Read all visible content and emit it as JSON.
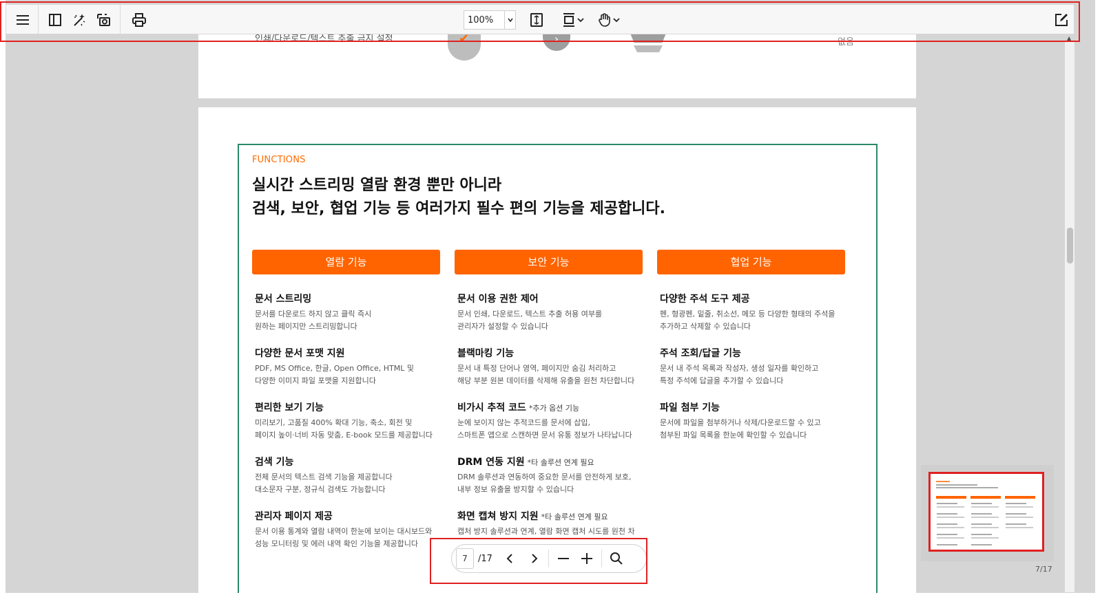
{
  "toolbar": {
    "menu_icon": "hamburger-menu-icon",
    "sidebar_icon": "sidebar-panel-icon",
    "tools": [
      "sidebar-panel-icon",
      "magic-wand-icon",
      "capture-icon",
      "print-icon"
    ],
    "zoom_value": "100%",
    "fit_page_icon": "fit-page-icon",
    "scroll_mode_icon": "vertical-scroll-icon",
    "hand_tool_icon": "hand-tool-icon",
    "edit_icon": "edit-icon"
  },
  "previous_page": {
    "text": "인쇄/다운로드/텍스트 추출 금지 설정",
    "right_text": "없음"
  },
  "page": {
    "label": "FUNCTIONS",
    "headline_line1": "실시간 스트리밍 열람 환경 뿐만 아니라",
    "headline_line2": "검색, 보안, 협업 기능 등 여러가지 필수 편의 기능을 제공합니다.",
    "columns": [
      {
        "header": "열람 기능",
        "items": [
          {
            "title": "문서 스트리밍",
            "note": "",
            "desc1": "문서를 다운로드 하지 않고 클릭 즉시",
            "desc2": "원하는 페이지만 스트리밍합니다"
          },
          {
            "title": "다양한 문서 포맷 지원",
            "note": "",
            "desc1": "PDF, MS Office, 한글, Open Office, HTML 및",
            "desc2": "다양한 이미지 파일 포맷을 지원합니다"
          },
          {
            "title": "편리한 보기 기능",
            "note": "",
            "desc1": "미리보기, 고품질 400% 확대 기능, 축소, 회전 및",
            "desc2": "페이지 높이·너비 자동 맞춤, E-book 모드를 제공합니다"
          },
          {
            "title": "검색 기능",
            "note": "",
            "desc1": "전체 문서의 텍스트 검색 기능을 제공합니다",
            "desc2": "대소문자 구분, 정규식 검색도 가능합니다"
          },
          {
            "title": "관리자 페이지 제공",
            "note": "",
            "desc1": "문서 이용 통계와 열람 내역이 한눈에 보이는 대시보드와",
            "desc2": "성능 모니터링 및 에러 내역 확인 기능을 제공합니다"
          }
        ]
      },
      {
        "header": "보안 기능",
        "items": [
          {
            "title": "문서 이용 권한 제어",
            "note": "",
            "desc1": "문서 인쇄, 다운로드, 텍스트 추출 허용 여부를",
            "desc2": "관리자가 설정할 수 있습니다"
          },
          {
            "title": "블랙마킹 기능",
            "note": "",
            "desc1": "문서 내 특정 단어나 영역, 페이지만 숨김 처리하고",
            "desc2": "해당 부분 원본 데이터를 삭제해 유출을 원천 차단합니다"
          },
          {
            "title": "비가시 추적 코드",
            "note": "*추가 옵션 기능",
            "desc1": "눈에 보이지 않는 추적코드를 문서에 삽입,",
            "desc2": "스마트폰 앱으로 스캔하면 문서 유통 정보가 나타납니다"
          },
          {
            "title": "DRM 연동 지원",
            "note": "*타 솔루션 연계 필요",
            "desc1": "DRM 솔루션과 연동하여 중요한 문서를 안전하게 보호,",
            "desc2": "내부 정보 유출을 방지할 수 있습니다"
          },
          {
            "title": "화면 캡쳐 방지 지원",
            "note": "*타 솔루션 연계 필요",
            "desc1": "캡처 방지 솔루션과 연계, 열람 화면 캡처 시도를 원천 차",
            "desc2": ""
          }
        ]
      },
      {
        "header": "협업 기능",
        "items": [
          {
            "title": "다양한 주석 도구 제공",
            "note": "",
            "desc1": "펜, 형광펜, 밑줄, 취소선, 메모 등 다양한 형태의 주석을",
            "desc2": "추가하고 삭제할 수 있습니다"
          },
          {
            "title": "주석 조회/답글 기능",
            "note": "",
            "desc1": "문서 내 주석 목록과 작성자, 생성 일자를 확인하고",
            "desc2": "특정 주석에 답글을 추가할 수 있습니다"
          },
          {
            "title": "파일 첨부 기능",
            "note": "",
            "desc1": "문서에 파일을 첨부하거나 삭제/다운로드할 수 있고",
            "desc2": "첨부된 파일 목록을 한눈에 확인할 수 있습니다"
          }
        ]
      }
    ]
  },
  "navigation": {
    "current_page": "7",
    "total_pages": "/17",
    "prev_icon": "chevron-left-icon",
    "next_icon": "chevron-right-icon",
    "zoom_out_icon": "minus-icon",
    "zoom_in_icon": "plus-icon",
    "search_icon": "search-icon"
  },
  "thumbnail": {
    "label": "7/17"
  },
  "colors": {
    "accent": "#ff6400",
    "frame": "#2a8a66",
    "highlight": "#e02020"
  }
}
